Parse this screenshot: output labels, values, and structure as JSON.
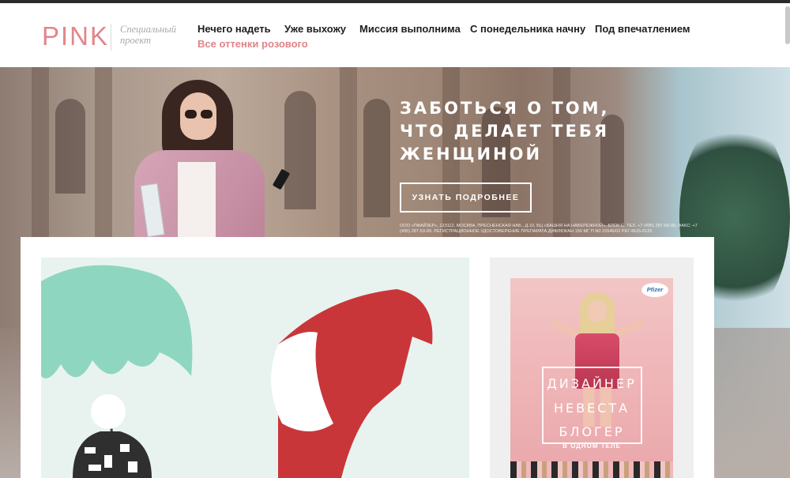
{
  "header": {
    "logo": "PINK",
    "tagline": "Специальный проект",
    "nav": [
      {
        "label": "Нечего надеть"
      },
      {
        "label": "Уже выхожу"
      },
      {
        "label": "Миссия выполнима"
      },
      {
        "label": "С понедельника начну"
      },
      {
        "label": "Под впечатлением"
      },
      {
        "label": "Все оттенки розового",
        "active": true
      }
    ]
  },
  "hero": {
    "title": "ЗАБОТЬСЯ О ТОМ,\nЧТО ДЕЛАЕТ ТЕБЯ\nЖЕНЩИНОЙ",
    "button": "УЗНАТЬ ПОДРОБНЕЕ",
    "fine_print": "ООО «ПФАЙЗЕР», 123112, МОСКВА, ПРЕСНЕНСКАЯ НАБ., Д.10, БЦ «БАШНЯ НА НАБЕРЕЖНОЙ», БЛОК С. ТЕЛ. +7 (495) 287-50-00, ФАКС: +7 (495) 287-53-00. РЕГИСТРАЦИОННОЕ УДОСТОВЕРЕНИЕ ПРЕПАРАТА ДИФЛЮКАН 150 МГ П N0 15546/02 РЕГ-RUS-0125"
  },
  "sidebar_ad": {
    "brand": "Pfizer",
    "line1": "ДИЗАЙНЕР",
    "line2": "НЕВЕСТА",
    "line3": "БЛОГЕР",
    "line4": "В ОДНОМ ТЕЛЕ"
  },
  "colors": {
    "brand_pink": "#e2868a",
    "nav_text": "#1e1e1e",
    "feature_red": "#c9363a",
    "feature_mint": "#8fd6c0"
  }
}
